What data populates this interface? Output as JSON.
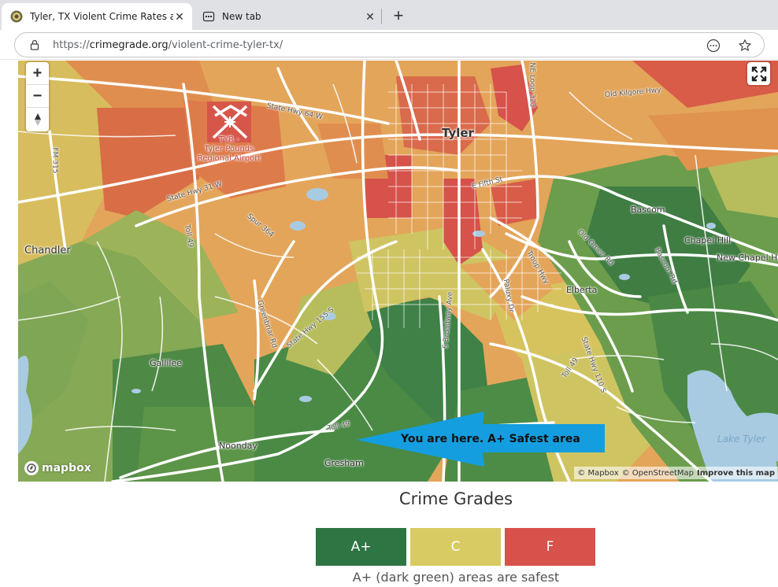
{
  "browser": {
    "tabs": [
      {
        "title": "Tyler, TX Violent Crime Rates and",
        "active": true
      },
      {
        "title": "New tab",
        "active": false
      }
    ],
    "new_tab_symbol": "+",
    "close_symbol": "✕",
    "url_prefix": "https://",
    "url_host": "crimegrade.org",
    "url_path": "/violent-crime-tyler-tx/"
  },
  "map": {
    "zoom_in": "+",
    "zoom_out": "−",
    "compass": "▲",
    "labels": {
      "tyler": "Tyler",
      "chandler": "Chandler",
      "bascom": "Bascom",
      "chapel_hill": "Chapel Hill",
      "new_chapel_hill": "New Chapel Hi",
      "elberta": "Elberta",
      "gallilee": "Gallilee",
      "noonday": "Noonday",
      "gresham": "Gresham",
      "lake_tyler": "Lake Tyler",
      "airport_line1": "TYR -",
      "airport_line2": "Tyler Pounds",
      "airport_line3": "Regional Airport",
      "hwy64": "State Hwy 64 W",
      "hwy31": "State Hwy 31 W",
      "fm315": "FM 315",
      "toll49_a": "Toll 49",
      "toll49_b": "Toll 49",
      "toll49_c": "Toll 49",
      "spur364": "Spur 364",
      "greenbriar": "Greenbriar Rd",
      "hwy155": "State Hwy 155 S",
      "broadway": "S Broadway Ave",
      "paluxy": "Paluxy Dr",
      "troup": "Troup Hwy",
      "old_omen": "Old Omen Rd",
      "bascom_rd": "Bascom Rd",
      "hwy110": "State Hwy 110 S",
      "fifth": "E Fifth St",
      "loop323": "NE Loop 323",
      "kilgore": "Old Kilgore Hwy"
    },
    "callout": "You are here. A+ Safest area",
    "logo": "mapbox",
    "attribution": {
      "mapbox": "© Mapbox",
      "osm": "© OpenStreetMap",
      "improve": "Improve this map"
    }
  },
  "legend": {
    "title": "Crime Grades",
    "grades": [
      {
        "label": "A+",
        "color": "#2e7544"
      },
      {
        "label": "C",
        "color": "#d9cb63"
      },
      {
        "label": "F",
        "color": "#d6524a"
      }
    ],
    "note": "A+ (dark green) areas are safest"
  },
  "colors": {
    "grade_a": "#3f8146",
    "grade_b": "#8aad55",
    "grade_c": "#cfc462",
    "grade_d": "#e3a55a",
    "grade_f": "#d85c48",
    "water": "#a8cbe2",
    "callout_arrow": "#149ee0"
  }
}
